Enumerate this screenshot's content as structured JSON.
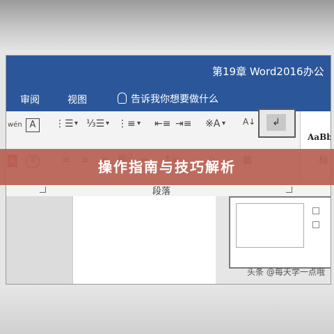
{
  "titlebar": {
    "title": "第19章  Word2016办公"
  },
  "tabs": [
    {
      "label": "审阅"
    },
    {
      "label": "视图"
    }
  ],
  "tellme": {
    "text": "告诉我你想要做什么"
  },
  "ribbon": {
    "row1_glyphs": [
      "wén",
      "A"
    ],
    "style_sample": "AaBb",
    "style_sample_2": "标",
    "paragraph_label": "段落",
    "sort_icon": "↲"
  },
  "banner": {
    "text": "操作指南与技巧解析"
  },
  "watermark": {
    "text": "头条 @每天学一点哦"
  },
  "colors": {
    "ribbon_blue": "#2b579a",
    "banner_red": "#b86052"
  }
}
